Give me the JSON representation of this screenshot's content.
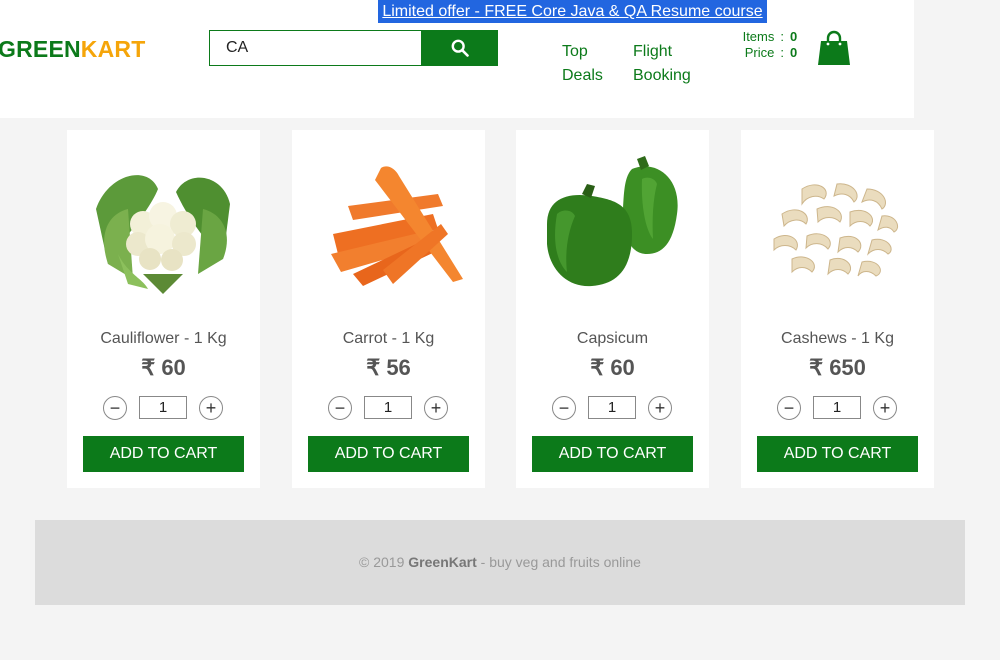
{
  "promo": {
    "text": "Limited offer - FREE Core Java & QA Resume course"
  },
  "brand": {
    "green": "GREEN",
    "kart": "KART"
  },
  "search": {
    "value": "CA",
    "icon": "search-icon"
  },
  "nav": [
    {
      "line1": "Top",
      "line2": "Deals"
    },
    {
      "line1": "Flight",
      "line2": "Booking"
    }
  ],
  "summary": {
    "items_label": "Items",
    "items_value": "0",
    "price_label": "Price",
    "price_value": "0",
    "separator": ":"
  },
  "cart": {
    "icon": "shopping-bag-icon"
  },
  "products": [
    {
      "name": "Cauliflower - 1 Kg",
      "price": "₹ 60",
      "qty": "1",
      "add_label": "ADD TO CART",
      "image": "cauliflower"
    },
    {
      "name": "Carrot - 1 Kg",
      "price": "₹ 56",
      "qty": "1",
      "add_label": "ADD TO CART",
      "image": "carrot"
    },
    {
      "name": "Capsicum",
      "price": "₹ 60",
      "qty": "1",
      "add_label": "ADD TO CART",
      "image": "capsicum"
    },
    {
      "name": "Cashews - 1 Kg",
      "price": "₹ 650",
      "qty": "1",
      "add_label": "ADD TO CART",
      "image": "cashews"
    }
  ],
  "stepper": {
    "minus": "−",
    "plus": "+"
  },
  "footer": {
    "prefix": "© 2019 ",
    "brand": "GreenKart",
    "suffix": " - buy veg and fruits online"
  },
  "colors": {
    "primary": "#0c7a1a",
    "accent": "#f5a50a",
    "promo": "#2266e0"
  }
}
